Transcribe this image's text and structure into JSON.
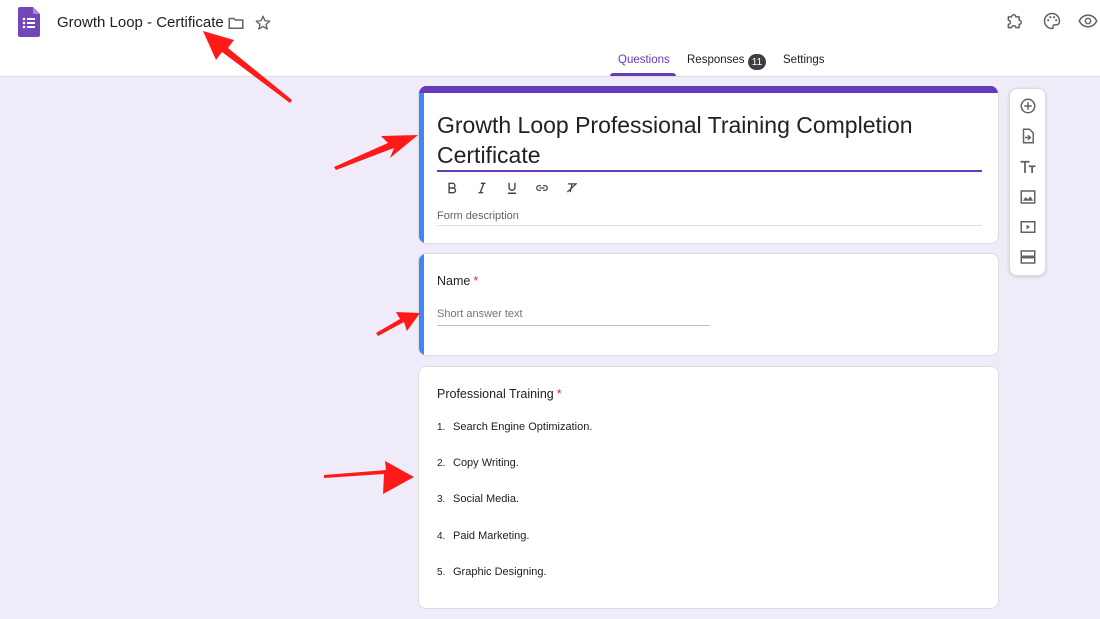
{
  "header": {
    "app_logo_icon": "google-forms-icon",
    "doc_title": "Growth Loop - Certificate",
    "icons": [
      "folder-icon",
      "star-icon",
      "addon-puzzle-icon",
      "palette-icon",
      "preview-eye-icon"
    ]
  },
  "tabs": {
    "questions": "Questions",
    "responses": "Responses",
    "responses_count": "11",
    "settings": "Settings"
  },
  "form": {
    "title": "Growth Loop Professional Training Completion Certificate",
    "description_placeholder": "Form description",
    "format_tools": [
      "bold-icon",
      "italic-icon",
      "underline-icon",
      "link-icon",
      "clear-format-icon"
    ]
  },
  "questions": [
    {
      "title": "Name",
      "required_mark": "*",
      "answer_placeholder": "Short answer text"
    },
    {
      "title": "Professional Training",
      "required_mark": "*",
      "items": [
        {
          "num": "1.",
          "text": "Search Engine Optimization."
        },
        {
          "num": "2.",
          "text": "Copy Writing."
        },
        {
          "num": "3.",
          "text": "Social Media."
        },
        {
          "num": "4.",
          "text": "Paid Marketing."
        },
        {
          "num": "5.",
          "text": "Graphic Designing."
        }
      ]
    }
  ],
  "side_toolbar": [
    "add-question-icon",
    "import-questions-icon",
    "add-title-icon",
    "add-image-icon",
    "add-video-icon",
    "add-section-icon"
  ],
  "colors": {
    "accent": "#673ab7",
    "active_border": "#4285f4",
    "background": "#f0ebf8",
    "required": "#d93025",
    "annotation_arrow": "#ff1a1a"
  }
}
